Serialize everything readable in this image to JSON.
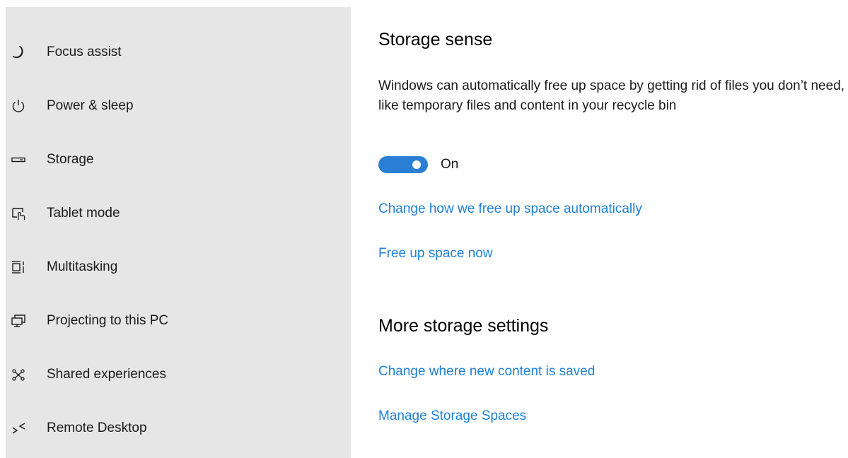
{
  "sidebar": {
    "items": [
      {
        "label": "Focus assist",
        "icon": "moon-icon"
      },
      {
        "label": "Power & sleep",
        "icon": "power-icon"
      },
      {
        "label": "Storage",
        "icon": "storage-drive-icon"
      },
      {
        "label": "Tablet mode",
        "icon": "tablet-mode-icon"
      },
      {
        "label": "Multitasking",
        "icon": "multitasking-icon"
      },
      {
        "label": "Projecting to this PC",
        "icon": "projecting-icon"
      },
      {
        "label": "Shared experiences",
        "icon": "shared-experiences-icon"
      },
      {
        "label": "Remote Desktop",
        "icon": "remote-desktop-icon"
      }
    ]
  },
  "storage_sense": {
    "title": "Storage sense",
    "description": "Windows can automatically free up space by getting rid of files you don’t need, like temporary files and content in your recycle bin",
    "toggle_state": "On",
    "toggle_on": true,
    "link_change": "Change how we free up space automatically",
    "link_free_up": "Free up space now"
  },
  "more_storage": {
    "title": "More storage settings",
    "link_new_content": "Change where new content is saved",
    "link_storage_spaces": "Manage Storage Spaces"
  },
  "colors": {
    "sidebar_bg": "#e6e6e6",
    "accent": "#2a7fd4",
    "link": "#1e80d6"
  }
}
